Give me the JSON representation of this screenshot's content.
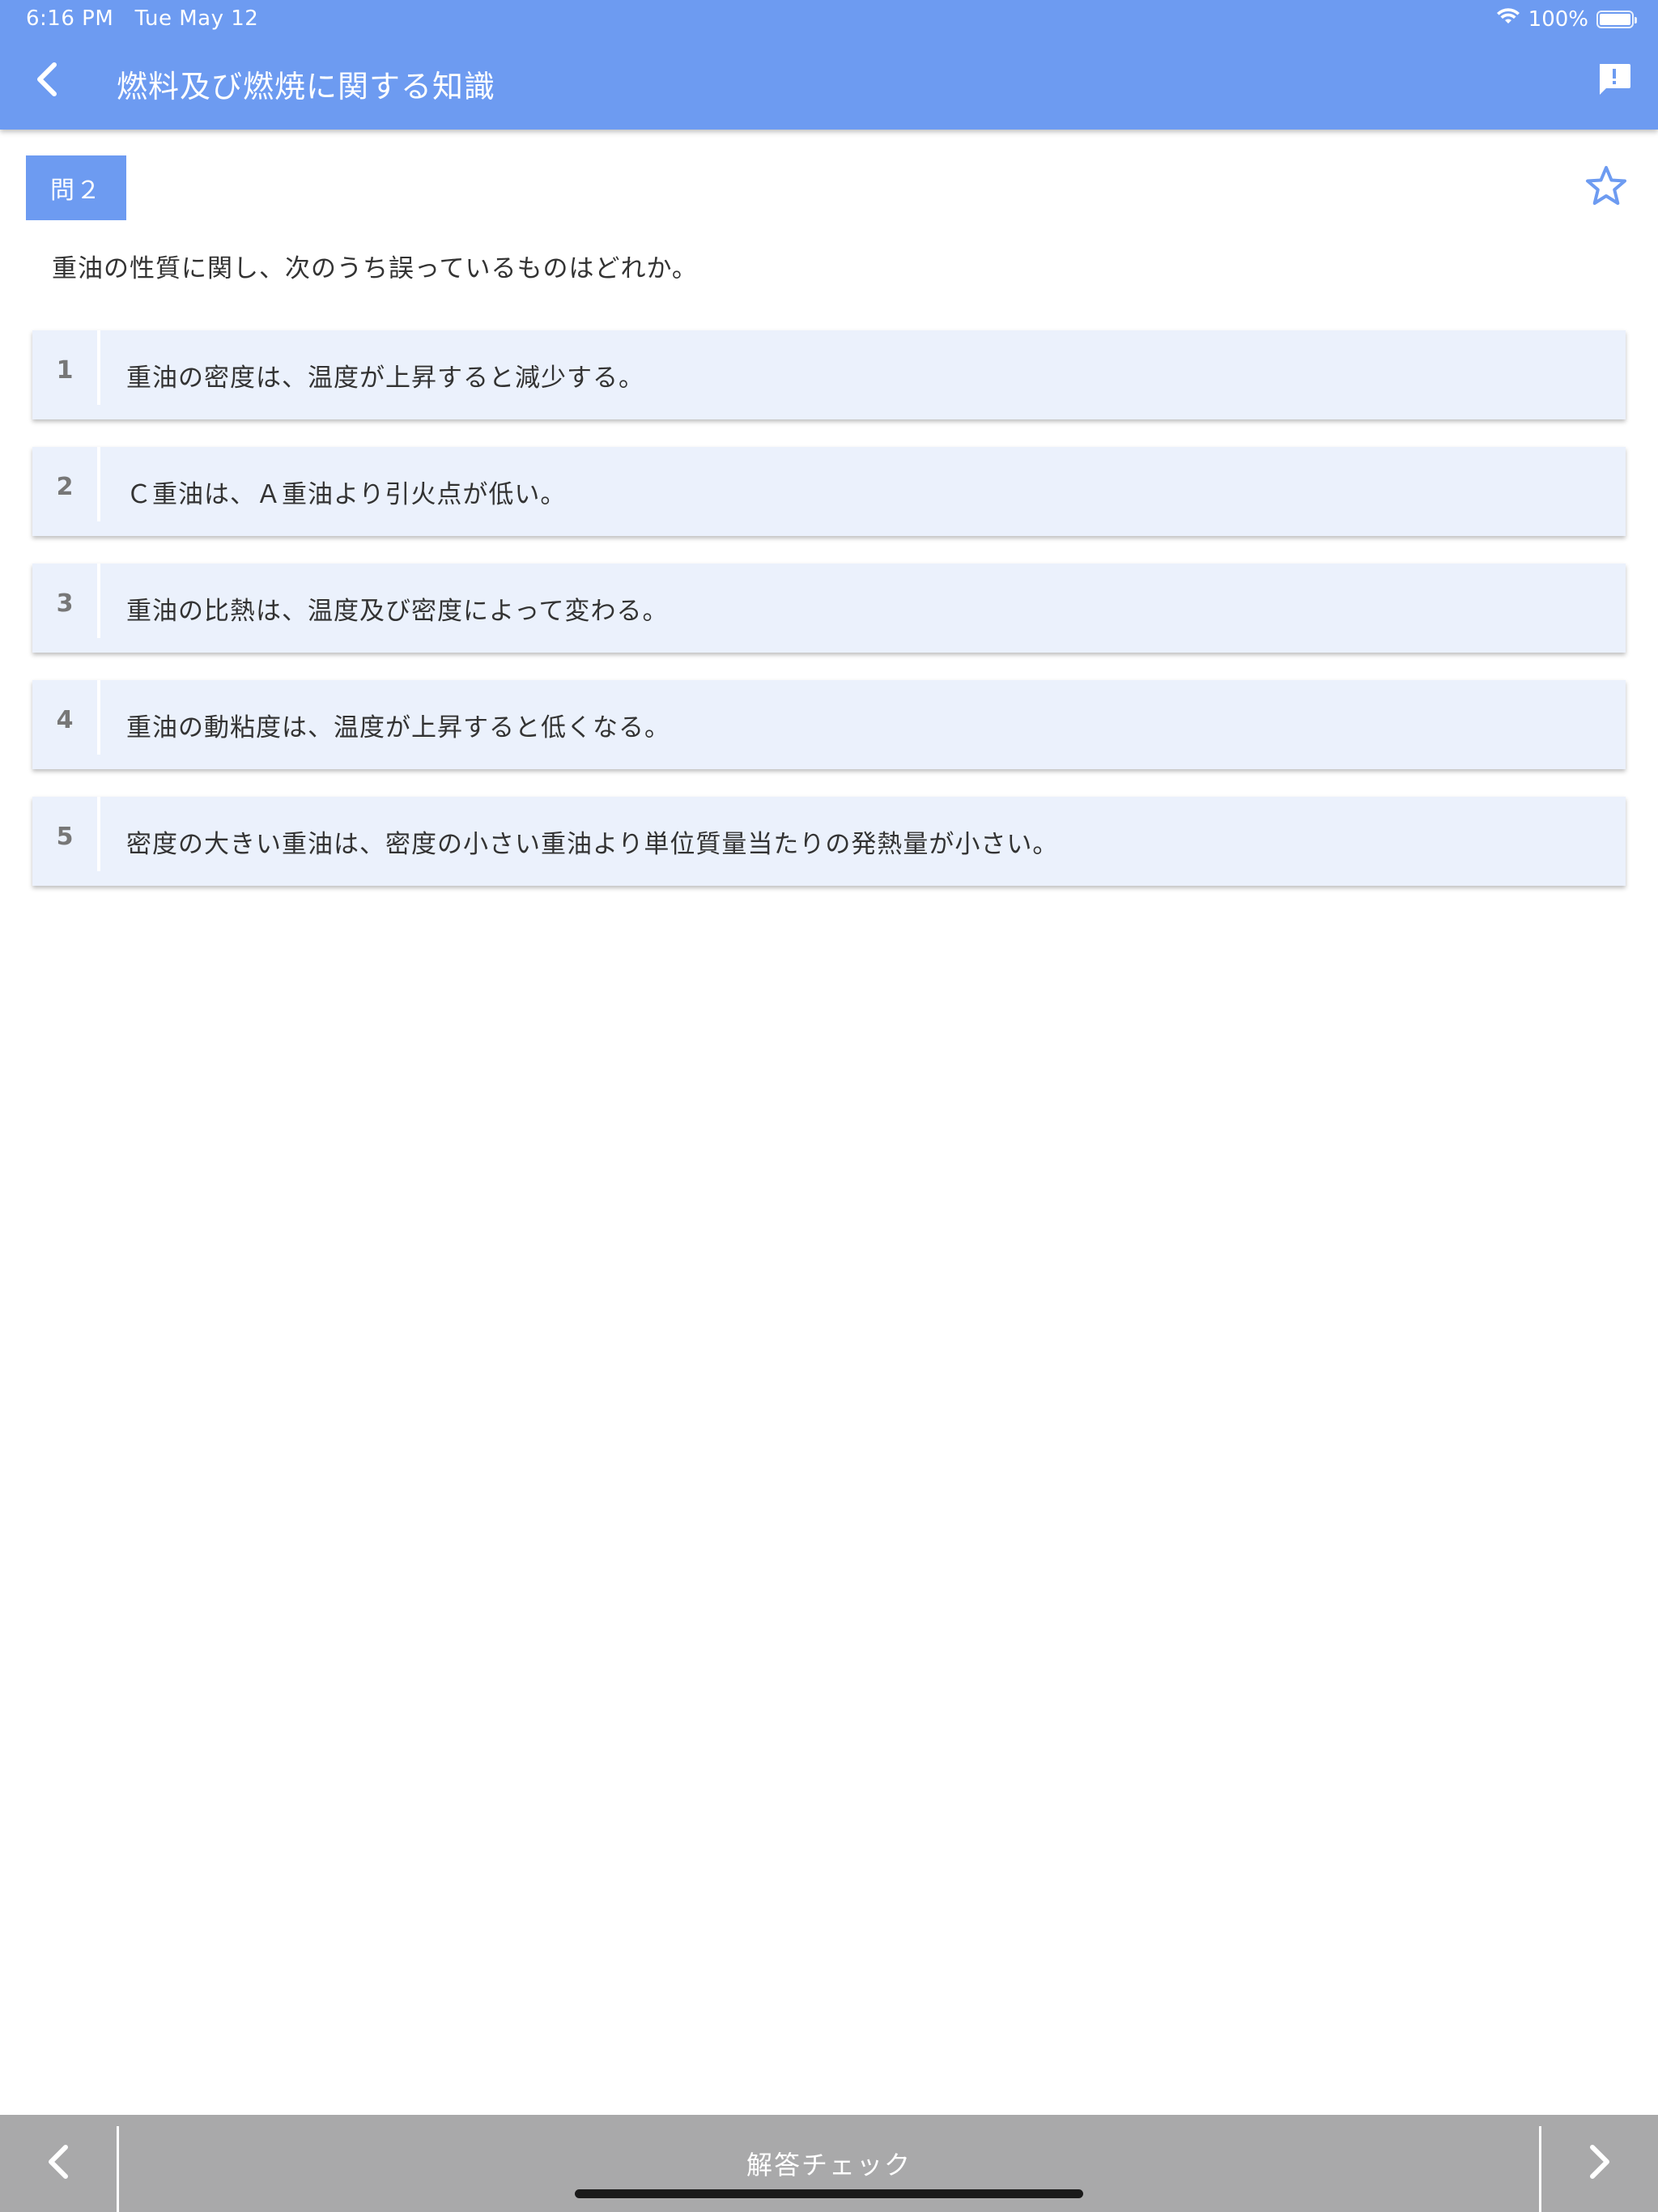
{
  "status": {
    "time": "6:16 PM",
    "date": "Tue May 12",
    "battery": "100%",
    "battery_level": 1.0
  },
  "header": {
    "title": "燃料及び燃焼に関する知識",
    "back_icon": "chevron-left-icon",
    "report_icon": "feedback-icon",
    "background": "#6d9bf1"
  },
  "question": {
    "number_label": "問２",
    "text": "重油の性質に関し、次のうち誤っているものはどれか。",
    "favorite_icon": "star-outline-icon"
  },
  "choices": [
    {
      "number": "1",
      "text": "重油の密度は、温度が上昇すると減少する。"
    },
    {
      "number": "2",
      "text": "Ｃ重油は、Ａ重油より引火点が低い。"
    },
    {
      "number": "3",
      "text": "重油の比熱は、温度及び密度によって変わる。"
    },
    {
      "number": "4",
      "text": "重油の動粘度は、温度が上昇すると低くなる。"
    },
    {
      "number": "5",
      "text": "密度の大きい重油は、密度の小さい重油より単位質量当たりの発熱量が小さい。"
    }
  ],
  "bottom_bar": {
    "check_label": "解答チェック",
    "prev_icon": "chevron-left-icon",
    "next_icon": "chevron-right-icon"
  }
}
